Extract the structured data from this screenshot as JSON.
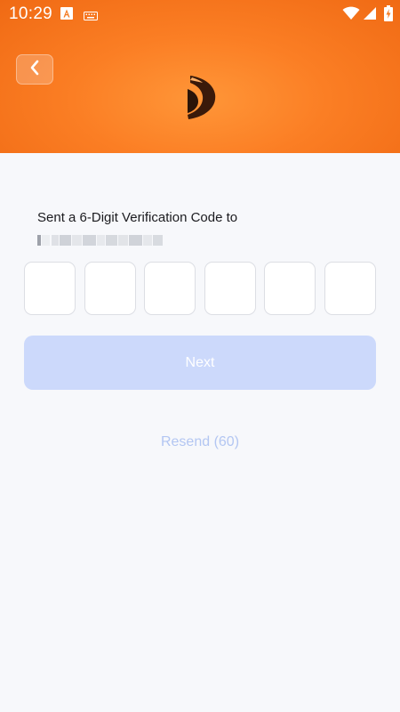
{
  "status_bar": {
    "time": "10:29",
    "left_icons": [
      "text-a-icon",
      "keyboard-icon"
    ],
    "right_icons": [
      "wifi-icon",
      "signal-icon",
      "battery-charging-icon"
    ]
  },
  "header": {
    "back_icon": "chevron-left-icon",
    "logo_icon": "brand-logo-icon",
    "gradient_colors": [
      "#ff9638",
      "#f06a14"
    ]
  },
  "verification": {
    "sent_label": "Sent a 6-Digit Verification Code to",
    "code_boxes": [
      "",
      "",
      "",
      "",
      "",
      ""
    ]
  },
  "actions": {
    "next_label": "Next",
    "next_color": "#ccd9fb",
    "resend_label": "Resend (60)",
    "resend_color": "#b3c6f2"
  }
}
